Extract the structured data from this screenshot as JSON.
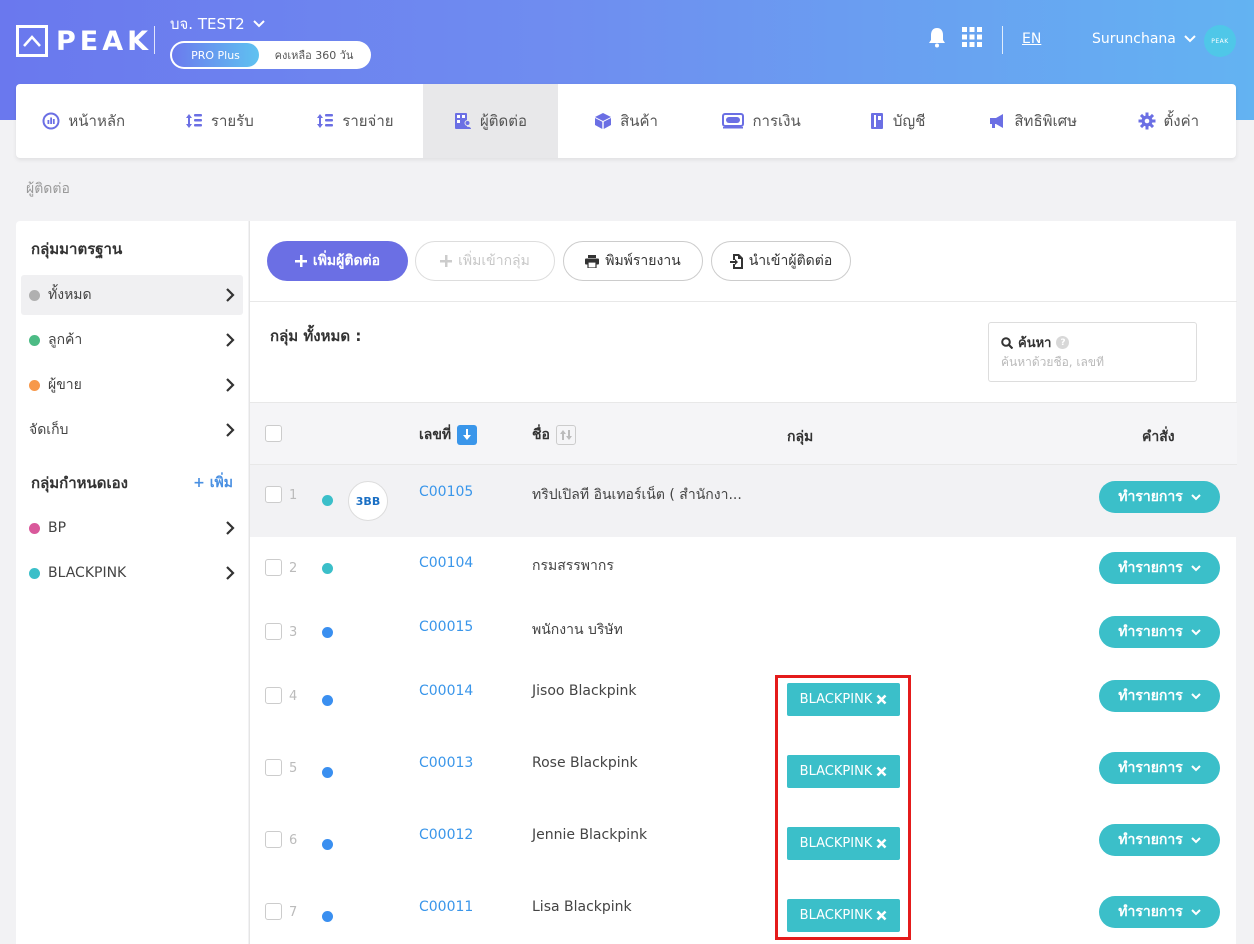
{
  "header": {
    "logo_text": "PEAK",
    "company": "บจ. TEST2",
    "plan_badge": "PRO Plus",
    "plan_days": "คงเหลือ 360 วัน",
    "lang": "EN",
    "user": "Surunchana",
    "avatar_text": "PEAK"
  },
  "nav": {
    "items": [
      {
        "label": "หน้าหลัก",
        "icon": "dashboard-icon"
      },
      {
        "label": "รายรับ",
        "icon": "income-icon"
      },
      {
        "label": "รายจ่าย",
        "icon": "expense-icon"
      },
      {
        "label": "ผู้ติดต่อ",
        "icon": "contacts-icon",
        "active": true
      },
      {
        "label": "สินค้า",
        "icon": "box-icon"
      },
      {
        "label": "การเงิน",
        "icon": "money-icon"
      },
      {
        "label": "บัญชี",
        "icon": "book-icon"
      },
      {
        "label": "สิทธิพิเศษ",
        "icon": "megaphone-icon"
      },
      {
        "label": "ตั้งค่า",
        "icon": "gear-icon"
      }
    ]
  },
  "breadcrumb": "ผู้ติดต่อ",
  "sidebar": {
    "standard_heading": "กลุ่มมาตรฐาน",
    "standard_items": [
      {
        "label": "ทั้งหมด",
        "color": "#b0b0b0",
        "active": true
      },
      {
        "label": "ลูกค้า",
        "color": "#4cbb85"
      },
      {
        "label": "ผู้ขาย",
        "color": "#f7984a"
      },
      {
        "label": "จัดเก็บ",
        "color": ""
      }
    ],
    "custom_heading": "กลุ่มกำหนดเอง",
    "custom_add": "+ เพิ่ม",
    "custom_items": [
      {
        "label": "BP",
        "color": "#d9589b"
      },
      {
        "label": "BLACKPINK",
        "color": "#3bbfc9"
      }
    ]
  },
  "toolbar": {
    "add_contact": "เพิ่มผู้ติดต่อ",
    "add_to_group": "เพิ่มเข้ากลุ่ม",
    "print_report": "พิมพ์รายงาน",
    "import_contacts": "นำเข้าผู้ติดต่อ"
  },
  "group_label": "กลุ่ม ทั้งหมด :",
  "search": {
    "title": "ค้นหา",
    "help": "?",
    "placeholder": "ค้นหาด้วยชื่อ, เลขที่"
  },
  "table": {
    "headers": {
      "code": "เลขที่",
      "name": "ชื่อ",
      "group": "กลุ่ม",
      "action": "คำสั่ง"
    },
    "action_label": "ทำรายการ",
    "rows": [
      {
        "idx": "1",
        "dot": "#3bbfc9",
        "code": "C00105",
        "name": "ทริปเปิลที อินเทอร์เน็ต ( สำนักงา...",
        "logo": "3BB",
        "tag": ""
      },
      {
        "idx": "2",
        "dot": "#3bbfc9",
        "code": "C00104",
        "name": "กรมสรรพากร",
        "tag": ""
      },
      {
        "idx": "3",
        "dot": "#3a8ff0",
        "code": "C00015",
        "name": "พนักงาน บริษัท",
        "tag": ""
      },
      {
        "idx": "4",
        "dot": "#3a8ff0",
        "code": "C00014",
        "name": "Jisoo Blackpink",
        "tag": "BLACKPINK"
      },
      {
        "idx": "5",
        "dot": "#3a8ff0",
        "code": "C00013",
        "name": "Rose Blackpink",
        "tag": "BLACKPINK"
      },
      {
        "idx": "6",
        "dot": "#3a8ff0",
        "code": "C00012",
        "name": "Jennie Blackpink",
        "tag": "BLACKPINK"
      },
      {
        "idx": "7",
        "dot": "#3a8ff0",
        "code": "C00011",
        "name": "Lisa Blackpink",
        "tag": "BLACKPINK"
      }
    ]
  },
  "colors": {
    "accent": "#6b6fe4",
    "teal": "#3bbfc9",
    "link": "#3a96ea",
    "highlight": "#e41b1b"
  }
}
